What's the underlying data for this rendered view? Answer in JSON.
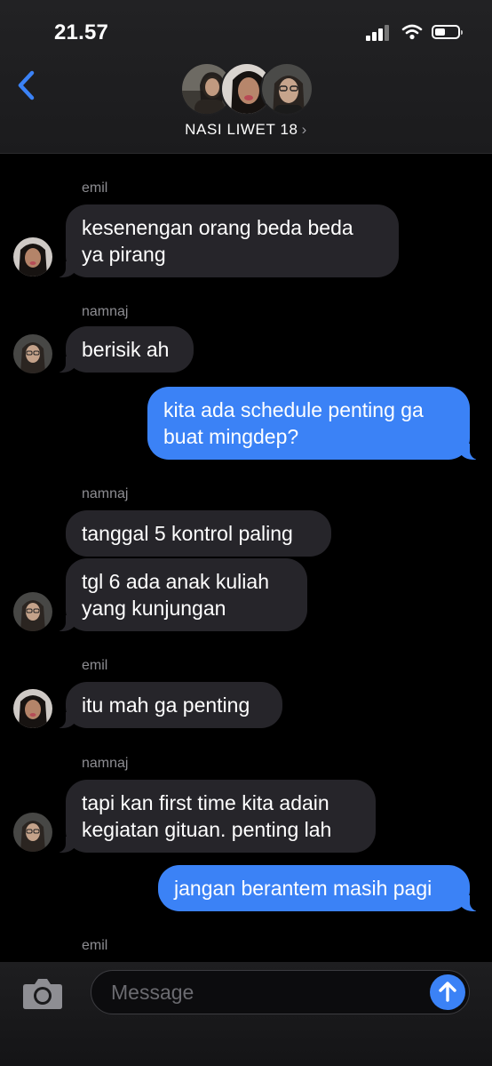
{
  "status_bar": {
    "time": "21.57"
  },
  "header": {
    "back_icon": "chevron-left-icon",
    "group_name": "NASI LIWET 18",
    "chevron": "›"
  },
  "messages": [
    {
      "sender": "emil",
      "text_lines": [
        "kesenengan orang beda beda",
        "ya pirang"
      ]
    },
    {
      "sender": "namnaj",
      "text_lines": [
        "berisik ah"
      ]
    },
    {
      "sender": "me",
      "text_lines": [
        "kita ada schedule penting ga",
        "buat mingdep?"
      ]
    },
    {
      "sender": "namnaj",
      "text_lines": [
        "tanggal 5 kontrol paling"
      ]
    },
    {
      "sender": "namnaj",
      "text_lines": [
        "tgl 6 ada anak kuliah",
        "yang kunjungan"
      ]
    },
    {
      "sender": "emil",
      "text_lines": [
        "itu mah ga penting"
      ]
    },
    {
      "sender": "namnaj",
      "text_lines": [
        "tapi kan first time kita adain",
        "kegiatan gituan. penting lah"
      ]
    },
    {
      "sender": "me",
      "text_lines": [
        "jangan berantem masih pagi"
      ]
    },
    {
      "sender": "emil",
      "text_lines": []
    }
  ],
  "composer": {
    "placeholder": "Message",
    "value": "",
    "camera_icon": "camera-icon",
    "send_icon": "arrow-up-icon"
  },
  "colors": {
    "accent": "#3b82f6",
    "incoming_bubble": "#26252a",
    "background": "#000000"
  }
}
